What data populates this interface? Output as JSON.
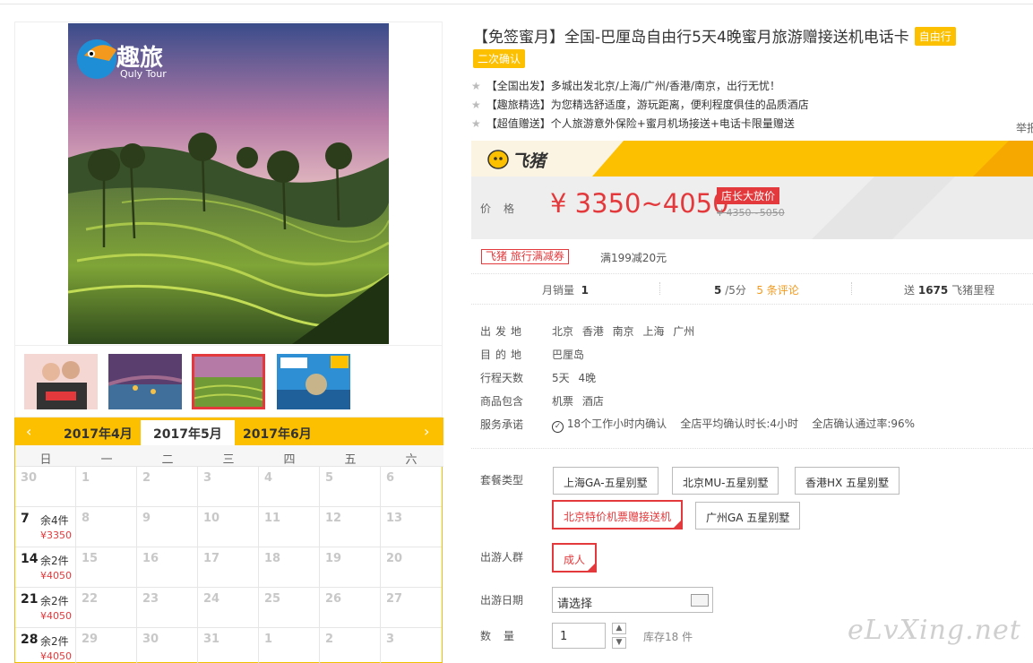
{
  "brand_logo_text": "趣旅",
  "brand_logo_sub": "Quly Tour",
  "calendar": {
    "prev_icon": "‹",
    "next_icon": "›",
    "months": [
      "2017年4月",
      "2017年5月",
      "2017年6月"
    ],
    "active_month": 1,
    "weekdays": [
      "日",
      "一",
      "二",
      "三",
      "四",
      "五",
      "六"
    ],
    "rows": [
      [
        {
          "d": "30"
        },
        {
          "d": "1"
        },
        {
          "d": "2"
        },
        {
          "d": "3"
        },
        {
          "d": "4"
        },
        {
          "d": "5"
        },
        {
          "d": "6"
        }
      ],
      [
        {
          "d": "7",
          "on": true,
          "left": "余4件",
          "price": "¥3350"
        },
        {
          "d": "8"
        },
        {
          "d": "9"
        },
        {
          "d": "10"
        },
        {
          "d": "11"
        },
        {
          "d": "12"
        },
        {
          "d": "13"
        }
      ],
      [
        {
          "d": "14",
          "on": true,
          "left": "余2件",
          "price": "¥4050"
        },
        {
          "d": "15"
        },
        {
          "d": "16"
        },
        {
          "d": "17"
        },
        {
          "d": "18"
        },
        {
          "d": "19"
        },
        {
          "d": "20"
        }
      ],
      [
        {
          "d": "21",
          "on": true,
          "left": "余2件",
          "price": "¥4050"
        },
        {
          "d": "22"
        },
        {
          "d": "23"
        },
        {
          "d": "24"
        },
        {
          "d": "25"
        },
        {
          "d": "26"
        },
        {
          "d": "27"
        }
      ],
      [
        {
          "d": "28",
          "on": true,
          "left": "余2件",
          "price": "¥4050"
        },
        {
          "d": "29"
        },
        {
          "d": "30"
        },
        {
          "d": "31"
        },
        {
          "d": "1"
        },
        {
          "d": "2"
        },
        {
          "d": "3"
        }
      ]
    ]
  },
  "product": {
    "title": "【免签蜜月】全国-巴厘岛自由行5天4晚蜜月旅游赠接送机电话卡",
    "tag1": "自由行",
    "tag2": "二次确认",
    "features": [
      {
        "k": "【全国出发】",
        "v": "多城出发北京/上海/广州/香港/南京，出行无忧！"
      },
      {
        "k": "【趣旅精选】",
        "v": "为您精选舒适度，游玩距离，便利程度俱佳的品质酒店"
      },
      {
        "k": "【超值赠送】",
        "v": "个人旅游意外保险+蜜月机场接送+电话卡限量赠送"
      }
    ],
    "report": "举报"
  },
  "fliggy": {
    "logo_text": "飞猪"
  },
  "price": {
    "label": "价格",
    "value": "¥ 3350~4050",
    "badge": "店长大放价",
    "old": "¥ 4350~5050"
  },
  "coupon": {
    "tag": "飞猪 旅行满减券",
    "text": "满199减20元"
  },
  "stats": {
    "monthly_label": "月销量",
    "monthly_value": "1",
    "score_value": "5",
    "score_suffix": "/5分",
    "reviews": "5 条评论",
    "miles_prefix": "送",
    "miles_value": "1675",
    "miles_suffix": "飞猪里程"
  },
  "info": [
    {
      "label": "出发地",
      "value": "北京 香港 南京 上海 广州"
    },
    {
      "label": "目的地",
      "value": "巴厘岛"
    },
    {
      "label": "行程天数",
      "value": "5天 4晚"
    },
    {
      "label": "商品包含",
      "value": "机票 酒店"
    }
  ],
  "service": {
    "label": "服务承诺",
    "items": [
      "18个工作小时内确认",
      "全店平均确认时长:4小时",
      "全店确认通过率:96%"
    ]
  },
  "packages": {
    "label": "套餐类型",
    "options": [
      "上海GA-五星别墅",
      "北京MU-五星别墅",
      "香港HX 五星别墅",
      "北京特价机票赠接送机",
      "广州GA 五星别墅"
    ],
    "selected": 3
  },
  "crowd": {
    "label": "出游人群",
    "option": "成人"
  },
  "date": {
    "label": "出游日期",
    "placeholder": "请选择"
  },
  "quantity": {
    "label": "数量",
    "value": "1",
    "stock": "库存18 件"
  },
  "watermark": "eLvXing.net",
  "colors": {
    "accent": "#fdc000",
    "price": "#e4393c"
  }
}
